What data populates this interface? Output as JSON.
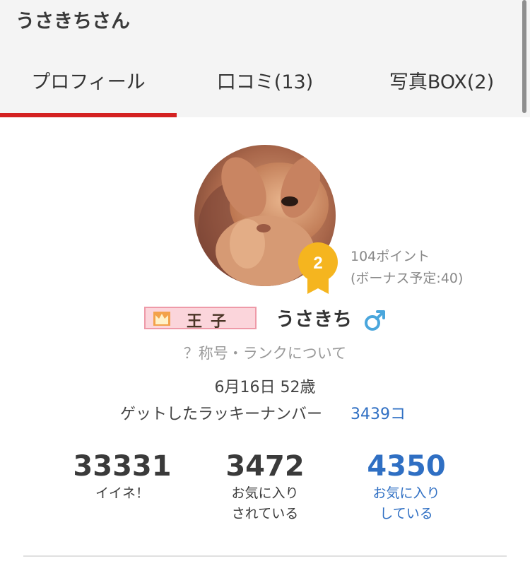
{
  "header": {
    "title": "うさきちさん"
  },
  "tabs": [
    {
      "label": "プロフィール",
      "active": true
    },
    {
      "label": "口コミ(13)",
      "active": false
    },
    {
      "label": "写真BOX(2)",
      "active": false
    }
  ],
  "profile": {
    "rank_number": "2",
    "points": "104ポイント",
    "bonus": "(ボーナス予定:40)",
    "title_badge": "王子",
    "username": "うさきち",
    "rank_help": "？称号・ランクについて",
    "birthday_age": "6月16日 52歳",
    "lucky_label": "ゲットしたラッキーナンバー",
    "lucky_count": "3439コ"
  },
  "stats": [
    {
      "value": "33331",
      "label_line1": "イイネ！",
      "label_line2": ""
    },
    {
      "value": "3472",
      "label_line1": "お気に入り",
      "label_line2": "されている"
    },
    {
      "value": "4350",
      "label_line1": "お気に入り",
      "label_line2": "している"
    }
  ],
  "colors": {
    "tab_indicator": "#d42121",
    "medal": "#f5b51f",
    "link_blue": "#2f6fc3",
    "male_blue": "#4aa6dc",
    "badge_pink": "#fbd5db"
  },
  "icons": [
    "crown-icon",
    "male-icon",
    "medal-icon"
  ]
}
